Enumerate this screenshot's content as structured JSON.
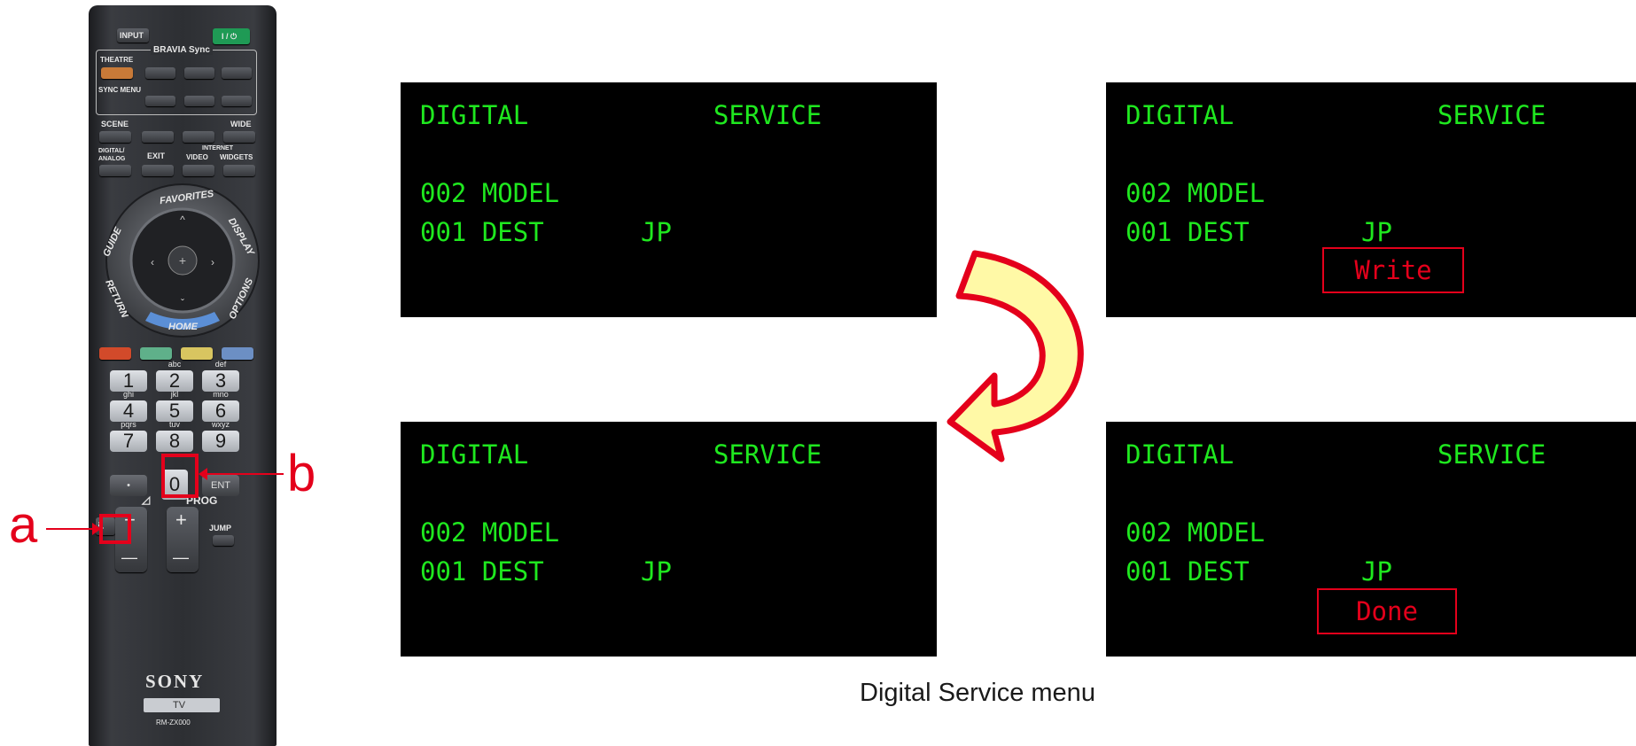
{
  "remote": {
    "top_buttons": {
      "input": "INPUT",
      "power": "I / ⏻"
    },
    "bravia_sync": "BRAVIA Sync",
    "theatre": "THEATRE",
    "sync_menu": "SYNC MENU",
    "row_labels": {
      "scene": "SCENE",
      "wide": "WIDE",
      "digital_analog": "DIGITAL/\nANALOG",
      "exit": "EXIT",
      "internet": "INTERNET",
      "video": "VIDEO",
      "widgets": "WIDGETS"
    },
    "ring": {
      "favorites": "FAVORITES",
      "display": "DISPLAY",
      "guide": "GUIDE",
      "options": "OPTIONS",
      "return": "RETURN",
      "home": "HOME"
    },
    "colors": [
      "#d24a2a",
      "#5fb08a",
      "#d8c560",
      "#6c8fc4"
    ],
    "digits": [
      {
        "key": "1",
        "sub": ""
      },
      {
        "key": "2",
        "sub": "abc"
      },
      {
        "key": "3",
        "sub": "def"
      },
      {
        "key": "4",
        "sub": "ghi"
      },
      {
        "key": "5",
        "sub": "jkl"
      },
      {
        "key": "6",
        "sub": "mno"
      },
      {
        "key": "7",
        "sub": "pqrs"
      },
      {
        "key": "8",
        "sub": "tuv"
      },
      {
        "key": "9",
        "sub": "wxyz"
      },
      {
        "key": "•",
        "sub": ""
      },
      {
        "key": "0",
        "sub": ""
      },
      {
        "key": "ENT",
        "sub": ""
      }
    ],
    "prog": "PROG",
    "plus": "+",
    "minus": "—",
    "jump": "JUMP",
    "brand": "SONY",
    "tv": "TV",
    "model": "RM-ZX000"
  },
  "callouts": {
    "a": "a",
    "b": "b"
  },
  "screens": [
    {
      "title_left": "DIGITAL",
      "title_right": "SERVICE",
      "line1": "002 MODEL",
      "line2_label": "001 DEST",
      "line2_value": "JP",
      "status": ""
    },
    {
      "title_left": "DIGITAL",
      "title_right": "SERVICE",
      "line1": "002 MODEL",
      "line2_label": "001 DEST",
      "line2_value": "JP",
      "status": "Write"
    },
    {
      "title_left": "DIGITAL",
      "title_right": "SERVICE",
      "line1": "002 MODEL",
      "line2_label": "001 DEST",
      "line2_value": "JP",
      "status": ""
    },
    {
      "title_left": "DIGITAL",
      "title_right": "SERVICE",
      "line1": "002 MODEL",
      "line2_label": "001 DEST",
      "line2_value": "JP",
      "status": "Done"
    }
  ],
  "caption": "Digital Service menu",
  "style_colors": {
    "screen_text": "#1fe81f",
    "highlight": "#e4001b",
    "arrow_fill": "#fff9a6"
  }
}
